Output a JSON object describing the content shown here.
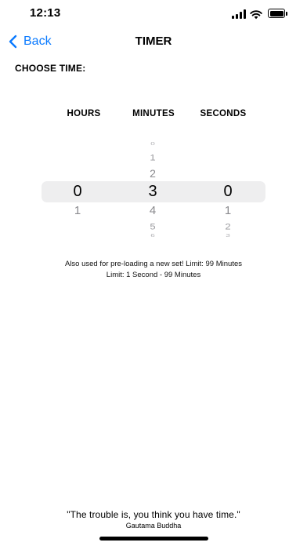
{
  "status": {
    "time": "12:13"
  },
  "nav": {
    "back_label": "Back",
    "title": "TIMER"
  },
  "choose_label": "CHOOSE TIME:",
  "columns": {
    "hours": "HOURS",
    "minutes": "MINUTES",
    "seconds": "SECONDS"
  },
  "picker": {
    "hours": {
      "selected": "0",
      "below1": "1"
    },
    "minutes": {
      "above3": "0",
      "above2": "1",
      "above1": "2",
      "selected": "3",
      "below1": "4",
      "below2": "5",
      "below3": "6"
    },
    "seconds": {
      "selected": "0",
      "below1": "1",
      "below2": "2",
      "below3": "3"
    }
  },
  "info": {
    "line1": "Also used for pre-loading a new set! Limit: 99 Minutes",
    "line2": "Limit: 1 Second - 99 Minutes"
  },
  "quote": {
    "text": "\"The trouble is, you think you have time.\"",
    "author": "Gautama Buddha"
  },
  "colors": {
    "accent": "#0a7aff",
    "highlight": "#eeeeef"
  }
}
